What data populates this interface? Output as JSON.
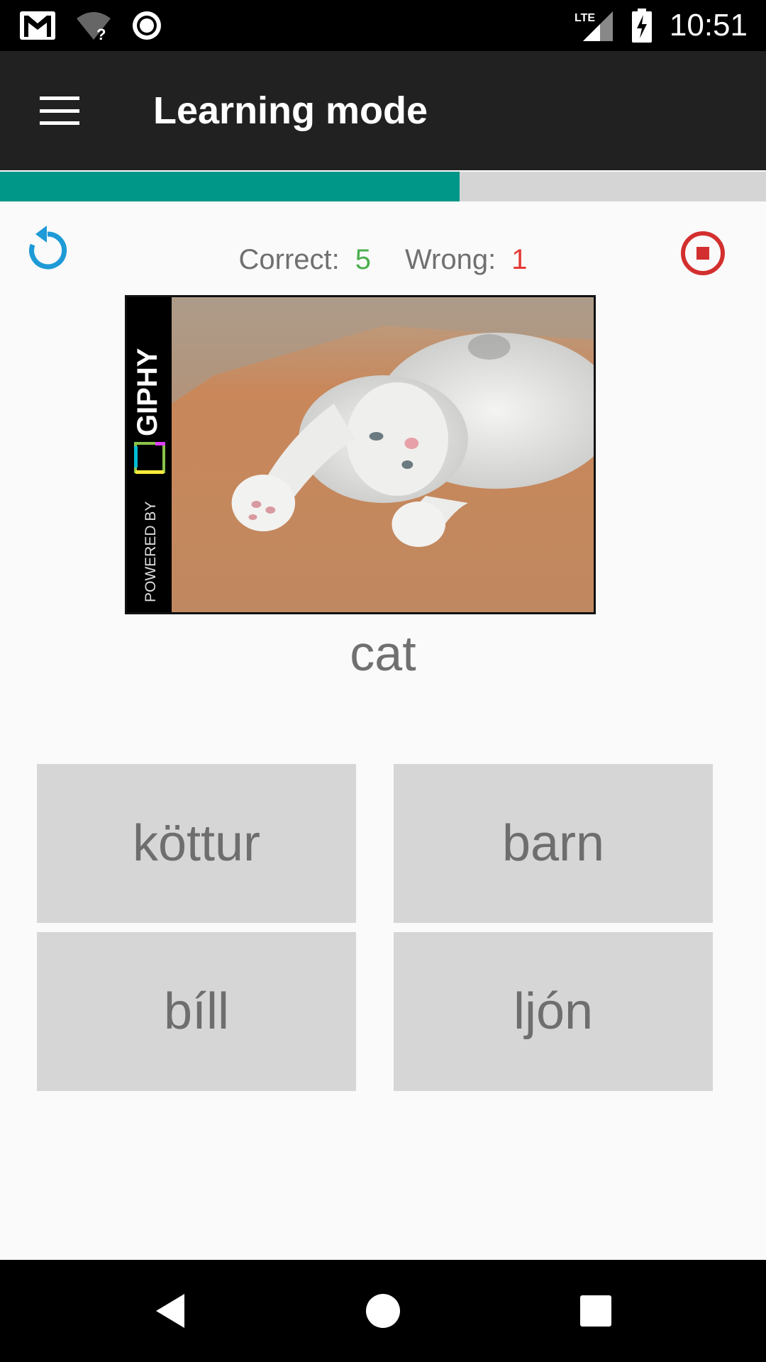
{
  "status_bar": {
    "time": "10:51",
    "network": "LTE",
    "icons": [
      "gmail-icon",
      "wifi-unknown-icon",
      "record-icon",
      "lte-signal-icon",
      "battery-charging-icon"
    ]
  },
  "app_bar": {
    "title": "Learning mode",
    "menu_icon": "hamburger-menu-icon"
  },
  "progress": {
    "fraction": 0.6,
    "fill_color": "#009688",
    "track_color": "#d5d5d5"
  },
  "score": {
    "correct_label": "Correct:",
    "correct_value": "5",
    "wrong_label": "Wrong:",
    "wrong_value": "1",
    "correct_color": "#4caf50",
    "wrong_color": "#e53935"
  },
  "controls": {
    "restart_icon": "restart-icon",
    "stop_icon": "stop-circle-icon",
    "restart_color": "#1e9ad6",
    "stop_color": "#d32f2f"
  },
  "image": {
    "watermark_powered": "POWERED BY",
    "watermark_brand": "GIPHY",
    "subject": "cat"
  },
  "prompt": {
    "word": "cat"
  },
  "answers": [
    {
      "label": "köttur"
    },
    {
      "label": "barn"
    },
    {
      "label": "bíll"
    },
    {
      "label": "ljón"
    }
  ],
  "nav_bar": {
    "back_icon": "back-icon",
    "home_icon": "home-icon",
    "recent_icon": "recent-apps-icon"
  }
}
